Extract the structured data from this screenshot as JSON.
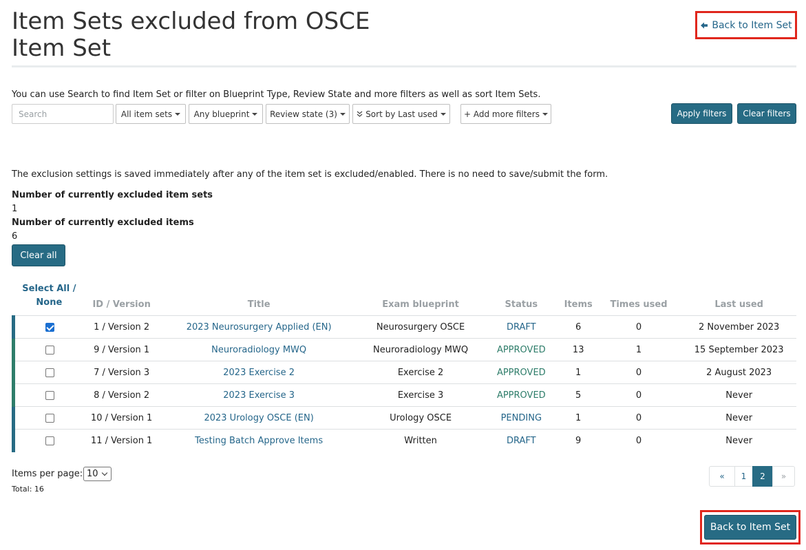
{
  "header": {
    "title_line1": "Item Sets excluded from OSCE",
    "title_line2": "Item Set",
    "back_link_label": "Back to Item Set"
  },
  "filters": {
    "help_text": "You can use Search to find Item Set or filter on Blueprint Type, Review State and more filters as well as sort Item Sets.",
    "search_placeholder": "Search",
    "item_sets_label": "All item sets",
    "blueprint_label": "Any blueprint",
    "review_state_label": "Review state (3)",
    "sort_label": "Sort by Last used",
    "add_filters_label": "+ Add more filters",
    "apply_label": "Apply filters",
    "clear_label": "Clear filters"
  },
  "info": {
    "exclusion_note": "The exclusion settings is saved immediately after any of the item set is excluded/enabled. There is no need to save/submit the form.",
    "excluded_sets_label": "Number of currently excluded item sets",
    "excluded_sets_value": "1",
    "excluded_items_label": "Number of currently excluded items",
    "excluded_items_value": "6",
    "clear_all_label": "Clear all"
  },
  "table": {
    "columns": {
      "select_all": "Select All /",
      "select_none": "None",
      "id_version": "ID / Version",
      "title": "Title",
      "exam_blueprint": "Exam blueprint",
      "status": "Status",
      "items": "Items",
      "times_used": "Times used",
      "last_used": "Last used"
    },
    "rows": [
      {
        "checked": true,
        "id_version": "1 / Version 2",
        "title": "2023 Neurosurgery Applied (EN)",
        "blueprint": "Neurosurgery OSCE",
        "status": "DRAFT",
        "items": "6",
        "times_used": "0",
        "last_used": "2 November 2023",
        "bar_color": "#276b84"
      },
      {
        "checked": false,
        "id_version": "9 / Version 1",
        "title": "Neuroradiology MWQ",
        "blueprint": "Neuroradiology MWQ",
        "status": "APPROVED",
        "items": "13",
        "times_used": "1",
        "last_used": "15 September 2023",
        "bar_color": "#2e7d6a"
      },
      {
        "checked": false,
        "id_version": "7 / Version 3",
        "title": "2023 Exercise 2",
        "blueprint": "Exercise 2",
        "status": "APPROVED",
        "items": "1",
        "times_used": "0",
        "last_used": "2 August 2023",
        "bar_color": "#2e7d6a"
      },
      {
        "checked": false,
        "id_version": "8 / Version 2",
        "title": "2023 Exercise 3",
        "blueprint": "Exercise 3",
        "status": "APPROVED",
        "items": "5",
        "times_used": "0",
        "last_used": "Never",
        "bar_color": "#2e7d6a"
      },
      {
        "checked": false,
        "id_version": "10 / Version 1",
        "title": "2023 Urology OSCE (EN)",
        "blueprint": "Urology OSCE",
        "status": "PENDING",
        "items": "1",
        "times_used": "0",
        "last_used": "Never",
        "bar_color": "#276b84"
      },
      {
        "checked": false,
        "id_version": "11 / Version 1",
        "title": "Testing Batch Approve Items",
        "blueprint": "Written",
        "status": "DRAFT",
        "items": "9",
        "times_used": "0",
        "last_used": "Never",
        "bar_color": "#276b84"
      }
    ]
  },
  "pagination": {
    "per_page_label": "Items per page:",
    "per_page_value": "10",
    "total_label": "Total: 16",
    "prev_label": "«",
    "pages": [
      "1",
      "2"
    ],
    "active_page": "2",
    "next_label": "»"
  },
  "footer": {
    "back_button_label": "Back to Item Set"
  },
  "colors": {
    "primary": "#276b84",
    "link": "#25668a",
    "approved": "#2e7d6a",
    "highlight_box": "#e0261c"
  },
  "icons": {
    "back_arrow": "arrow-left-icon",
    "dropdown": "caret-down-icon"
  }
}
